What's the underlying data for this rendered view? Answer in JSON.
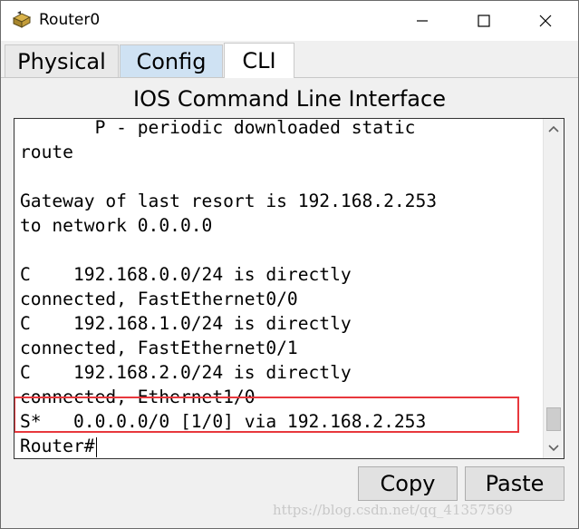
{
  "window": {
    "title": "Router0",
    "icon": "router-icon",
    "controls": {
      "minimize": "minimize-icon",
      "maximize": "maximize-icon",
      "close": "close-icon"
    }
  },
  "tabs": [
    {
      "label": "Physical",
      "active": false
    },
    {
      "label": "Config",
      "active": false
    },
    {
      "label": "CLI",
      "active": true
    }
  ],
  "cli": {
    "title": "IOS Command Line Interface",
    "lines": [
      "       P - periodic downloaded static",
      "route",
      "",
      "Gateway of last resort is 192.168.2.253",
      "to network 0.0.0.0",
      "",
      "C    192.168.0.0/24 is directly",
      "connected, FastEthernet0/0",
      "C    192.168.1.0/24 is directly",
      "connected, FastEthernet0/1",
      "C    192.168.2.0/24 is directly",
      "connected, Ethernet1/0",
      "S*   0.0.0.0/0 [1/0] via 192.168.2.253"
    ],
    "prompt": "Router#",
    "highlight_color": "#e8383d"
  },
  "buttons": {
    "copy": "Copy",
    "paste": "Paste"
  },
  "watermark": "https://blog.csdn.net/qq_41357569"
}
